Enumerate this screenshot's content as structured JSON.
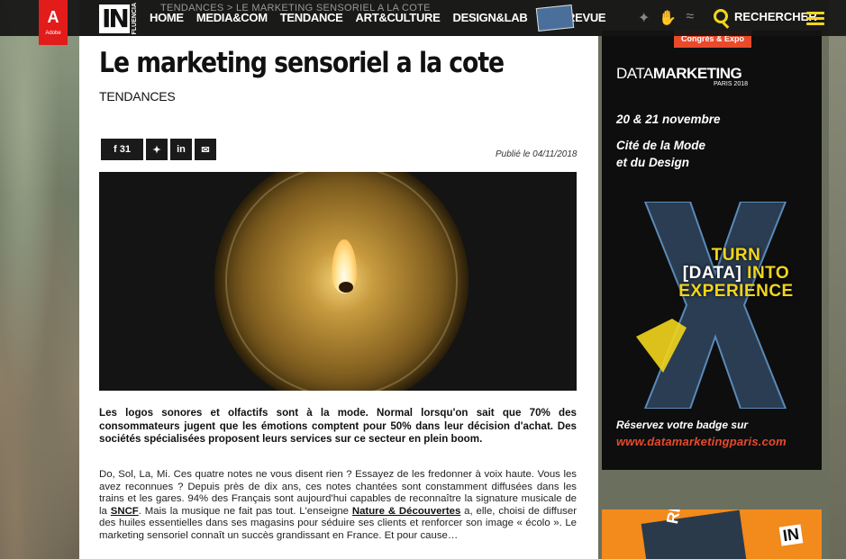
{
  "topbar": {
    "adobe_label": "Adobe",
    "logo_main": "IN",
    "logo_sub": "FLUENCIA",
    "breadcrumb": "TENDANCES  >  LE MARKETING SENSORIEL A LA COTE",
    "nav": [
      "HOME",
      "MEDIA&COM",
      "TENDANCE",
      "ART&CULTURE",
      "DESIGN&LAB"
    ],
    "revue": "LA REVUE",
    "search_label": "RECHERCHER"
  },
  "article": {
    "title": "Le marketing sensoriel a la cote",
    "category": "TENDANCES",
    "share_count": "31",
    "published": "Publié le 04/11/2018",
    "lead": "Les logos sonores et olfactifs sont à la mode. Normal lorsqu'on sait que 70% des consommateurs jugent que les émotions comptent pour 50% dans leur décision d'achat. Des sociétés spécialisées proposent leurs services sur ce secteur en plein boom.",
    "body_1": "Do, Sol, La, Mi. Ces quatre notes ne vous disent rien ? Essayez de les fredonner à voix haute. Vous les avez reconnues ? Depuis près de dix ans, ces notes chantées sont constamment diffusées dans les trains et les gares. 94% des Français sont aujourd'hui capables de reconnaître la signature musicale de la ",
    "link_sncf": "SNCF",
    "body_2": ". Mais la musique ne fait pas tout. L'enseigne ",
    "link_nature": "Nature & Découvertes",
    "body_3": " a, elle, choisi de diffuser des huiles essentielles dans ses magasins pour séduire ses clients et renforcer son image « écolo ». Le marketing sensoriel connaît un succès grandissant en France. Et pour cause…"
  },
  "ad": {
    "badge": "Congrès & Expo",
    "brand_light": "DATA",
    "brand_bold": "MARKETING",
    "city": "PARIS 2018",
    "dates": "20 & 21 novembre",
    "venue_1": "Cité de la Mode",
    "venue_2": "et du Design",
    "tag_1": "TURN",
    "tag_2": "[DATA]",
    "tag_3": "INTO",
    "tag_4": "EXPERIENCE",
    "cta": "Réservez votre badge sur",
    "url": "www.datamarketingparis.com"
  },
  "ad2": {
    "text": "RIES",
    "logo": "IN"
  },
  "colors": {
    "accent_yellow": "#f2d51c",
    "ad_orange": "#e84a2c",
    "topbar": "#141414"
  }
}
